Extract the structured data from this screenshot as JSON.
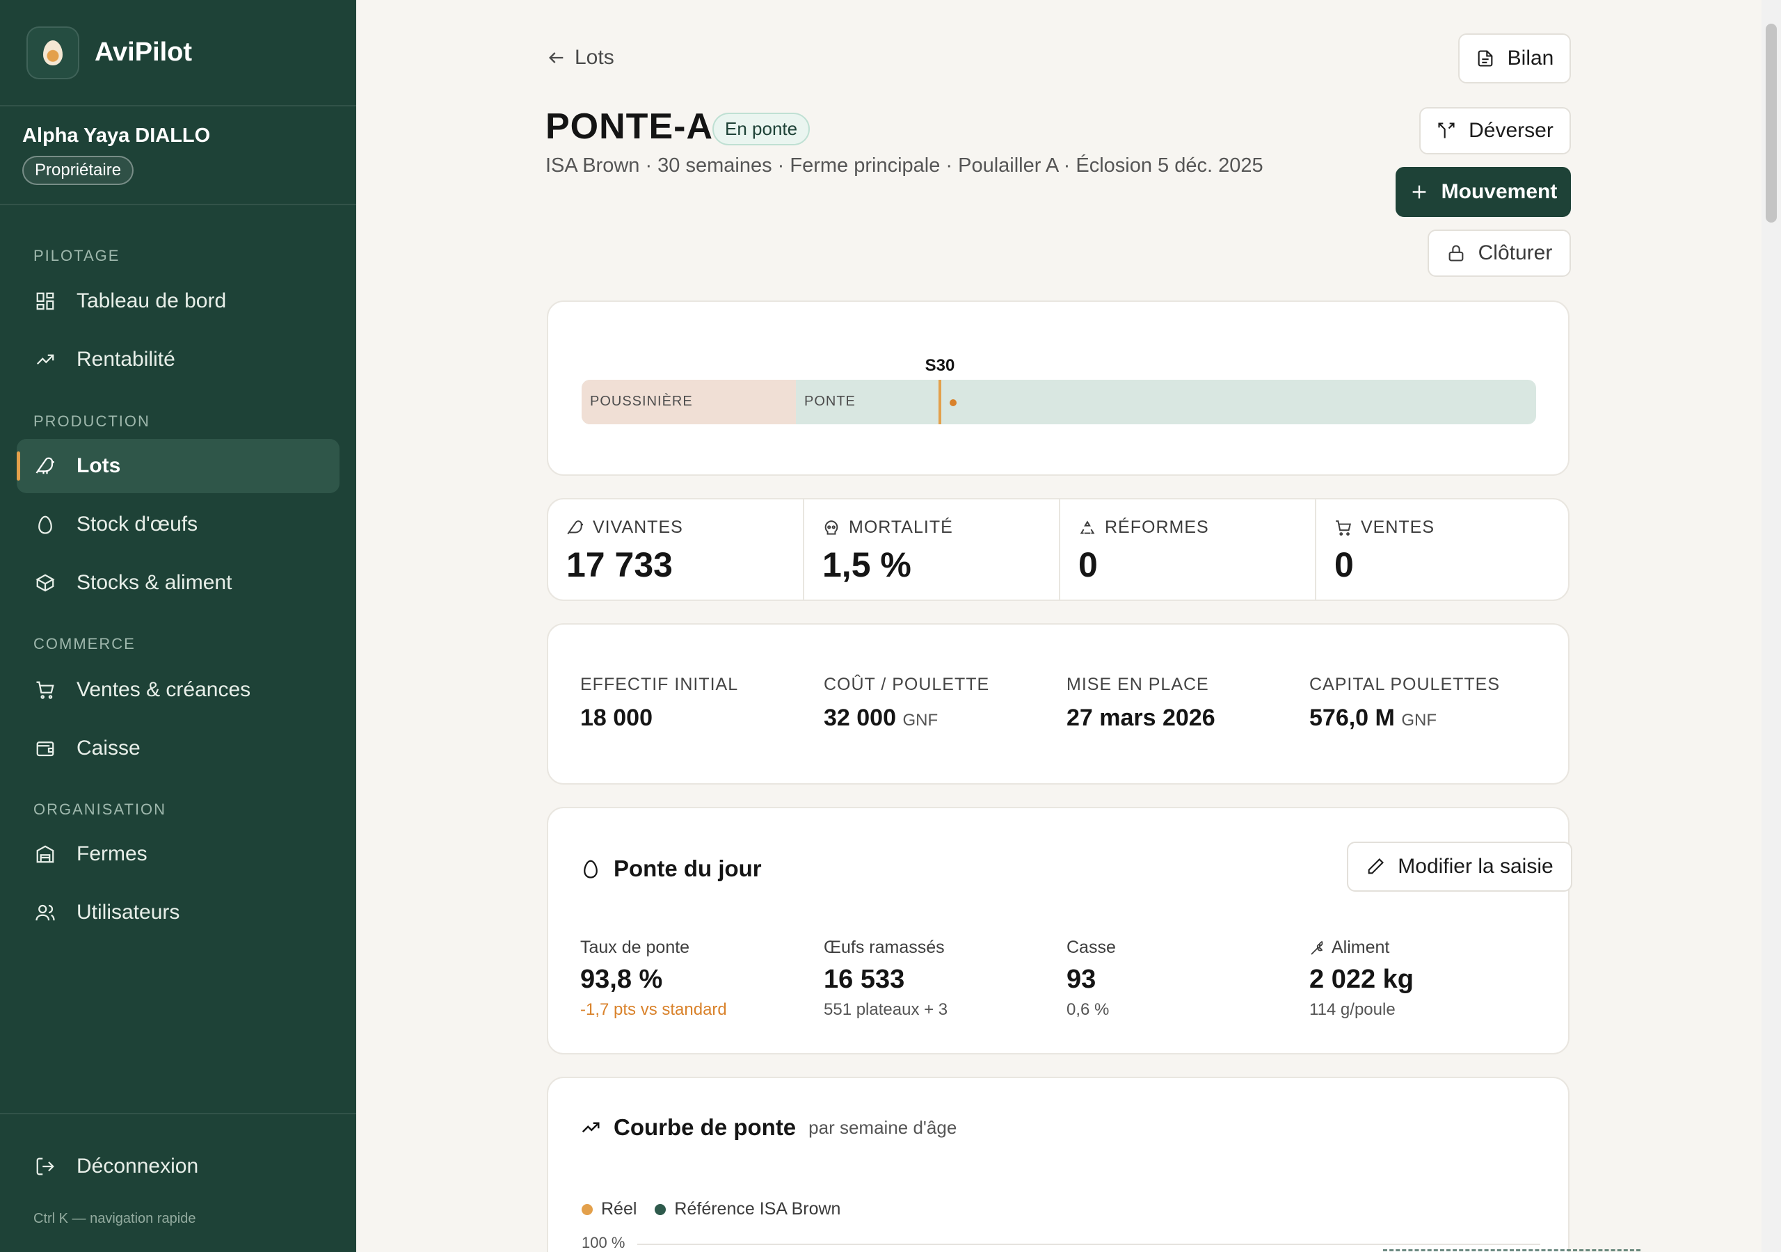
{
  "app": {
    "name": "AviPilot"
  },
  "user": {
    "name": "Alpha Yaya DIALLO",
    "role": "Propriétaire"
  },
  "nav": {
    "sections": [
      {
        "label": "PILOTAGE"
      },
      {
        "label": "PRODUCTION"
      },
      {
        "label": "COMMERCE"
      },
      {
        "label": "ORGANISATION"
      }
    ],
    "items": [
      {
        "label": "Tableau de bord",
        "icon": "dashboard-icon"
      },
      {
        "label": "Rentabilité",
        "icon": "trend-icon"
      },
      {
        "label": "Lots",
        "icon": "bird-icon",
        "active": true
      },
      {
        "label": "Stock d'œufs",
        "icon": "egg-icon"
      },
      {
        "label": "Stocks & aliment",
        "icon": "box-icon"
      },
      {
        "label": "Ventes & créances",
        "icon": "cart-icon"
      },
      {
        "label": "Caisse",
        "icon": "wallet-icon"
      },
      {
        "label": "Fermes",
        "icon": "building-icon"
      },
      {
        "label": "Utilisateurs",
        "icon": "users-icon"
      }
    ],
    "logout": "Déconnexion",
    "shortcut": "Ctrl K — navigation rapide"
  },
  "header": {
    "back_label": "Lots",
    "title": "PONTE-A",
    "status": "En ponte",
    "subtitle": "ISA Brown · 30 semaines · Ferme principale · Poulailler A · Éclosion 5 déc. 2025",
    "buttons": {
      "bilan": "Bilan",
      "deverser": "Déverser",
      "mouvement": "Mouvement",
      "cloturer": "Clôturer"
    }
  },
  "timeline": {
    "current_week_label": "S30",
    "phase_1": "POUSSINIÈRE",
    "phase_2": "PONTE",
    "current_fraction": 0.375
  },
  "stats": [
    {
      "label": "VIVANTES",
      "value": "17 733",
      "icon": "bird-icon"
    },
    {
      "label": "MORTALITÉ",
      "value": "1,5 %",
      "icon": "skull-icon"
    },
    {
      "label": "RÉFORMES",
      "value": "0",
      "icon": "recycle-icon"
    },
    {
      "label": "VENTES",
      "value": "0",
      "icon": "cart-icon"
    }
  ],
  "info": [
    {
      "label": "EFFECTIF INITIAL",
      "value": "18 000",
      "unit": ""
    },
    {
      "label": "COÛT / POULETTE",
      "value": "32 000",
      "unit": "GNF"
    },
    {
      "label": "MISE EN PLACE",
      "value": "27 mars 2026",
      "unit": ""
    },
    {
      "label": "CAPITAL POULETTES",
      "value": "576,0 M",
      "unit": "GNF"
    }
  ],
  "daily": {
    "title": "Ponte du jour",
    "edit_button": "Modifier la saisie",
    "cells": [
      {
        "label": "Taux de ponte",
        "value": "93,8 %",
        "note": "-1,7 pts vs standard"
      },
      {
        "label": "Œufs ramassés",
        "value": "16 533",
        "note": "551 plateaux + 3"
      },
      {
        "label": "Casse",
        "value": "93",
        "note": "0,6 %"
      },
      {
        "label": "Aliment",
        "value": "2 022 kg",
        "note": "114 g/poule"
      }
    ]
  },
  "curve": {
    "title": "Courbe de ponte",
    "subtitle": "par semaine d'âge",
    "legend": {
      "real": "Réel",
      "reference": "Référence ISA Brown"
    },
    "y_top_label": "100 %"
  },
  "colors": {
    "sidebar": "#1e4237",
    "accent": "#e3a04b",
    "warn": "#d9822b",
    "background": "#f7f5f1"
  }
}
